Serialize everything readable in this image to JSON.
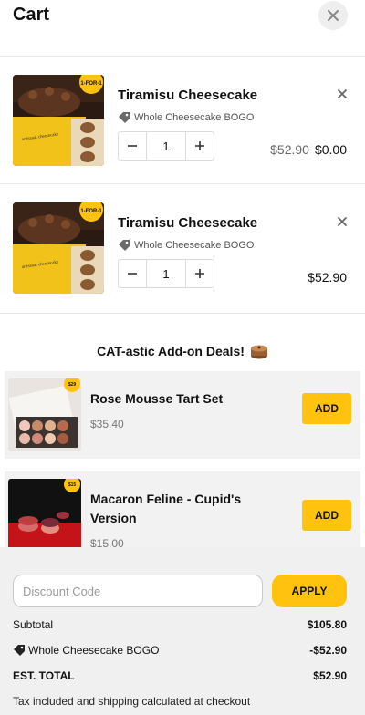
{
  "header": {
    "title": "Cart"
  },
  "cart_items": [
    {
      "name": "Tiramisu Cheesecake",
      "promo": "Whole Cheesecake BOGO",
      "quantity": "1",
      "price_original": "$52.90",
      "price": "$0.00",
      "badge": "1-FOR-1",
      "package_text": "artisanal cheesecake"
    },
    {
      "name": "Tiramisu Cheesecake",
      "promo": "Whole Cheesecake BOGO",
      "quantity": "1",
      "price": "$52.90",
      "badge": "1-FOR-1",
      "package_text": "artisanal cheesecake"
    }
  ],
  "addons": {
    "heading": "CAT-astic Add-on Deals!",
    "items": [
      {
        "name": "Rose Mousse Tart Set",
        "price": "$35.40",
        "add_label": "ADD",
        "badge": "$29"
      },
      {
        "name": "Macaron Feline - Cupid's Version",
        "price": "$15.00",
        "add_label": "ADD",
        "badge": "$15"
      }
    ]
  },
  "footer": {
    "discount_placeholder": "Discount Code",
    "apply_label": "APPLY",
    "subtotal_label": "Subtotal",
    "subtotal_value": "$105.80",
    "discount_label": "Whole Cheesecake BOGO",
    "discount_value": "-$52.90",
    "total_label": "EST. TOTAL",
    "total_value": "$52.90",
    "tax_note": "Tax included and shipping calculated at checkout"
  },
  "colors": {
    "accent": "#ffc20e",
    "footer_bg": "#f0f0f0",
    "card_bg": "#f2f2f2"
  },
  "icons": [
    "close-icon",
    "remove-icon",
    "tag-icon",
    "minus-icon",
    "plus-icon",
    "cake-icon"
  ]
}
